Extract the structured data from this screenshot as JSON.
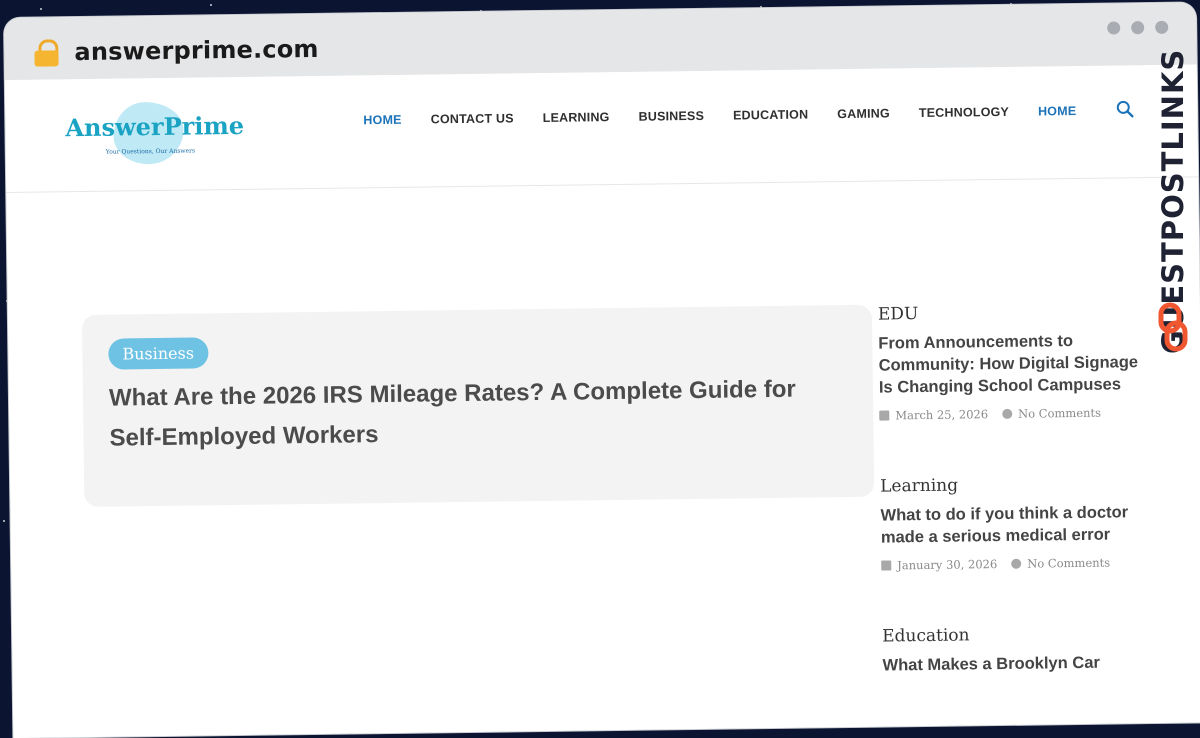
{
  "browser": {
    "url": "answerprime.com",
    "lock_icon": "lock-icon"
  },
  "site": {
    "logo": {
      "name": "AnswerPrime",
      "tagline": "Your Questions, Our Answers"
    },
    "nav": [
      {
        "label": "HOME",
        "active": true
      },
      {
        "label": "CONTACT US",
        "active": false
      },
      {
        "label": "LEARNING",
        "active": false
      },
      {
        "label": "BUSINESS",
        "active": false
      },
      {
        "label": "EDUCATION",
        "active": false
      },
      {
        "label": "GAMING",
        "active": false
      },
      {
        "label": "TECHNOLOGY",
        "active": false
      },
      {
        "label": "HOME",
        "active": true
      }
    ],
    "search_icon": "search-icon"
  },
  "hero": {
    "category": "Business",
    "title": "What Are the 2026 IRS Mileage Rates? A Complete Guide for Self-Employed Workers"
  },
  "sidebar": {
    "posts": [
      {
        "category": "EDU",
        "title": "From Announcements to Community: How Digital Signage Is Changing School Campuses",
        "date": "March 25, 2026",
        "comments": "No Comments"
      },
      {
        "category": "Learning",
        "title": "What to do if you think a doctor made a serious medical error",
        "date": "January 30, 2026",
        "comments": "No Comments"
      },
      {
        "category": "Education",
        "title": "What Makes a Brooklyn Car"
      }
    ]
  },
  "watermark": {
    "text": "GUESTPOSTLINKS"
  },
  "colors": {
    "accent": "#1c73b8",
    "logo": "#1aa3c2",
    "badge": "#6ec2e3",
    "watermark_link": "#f0562f"
  }
}
